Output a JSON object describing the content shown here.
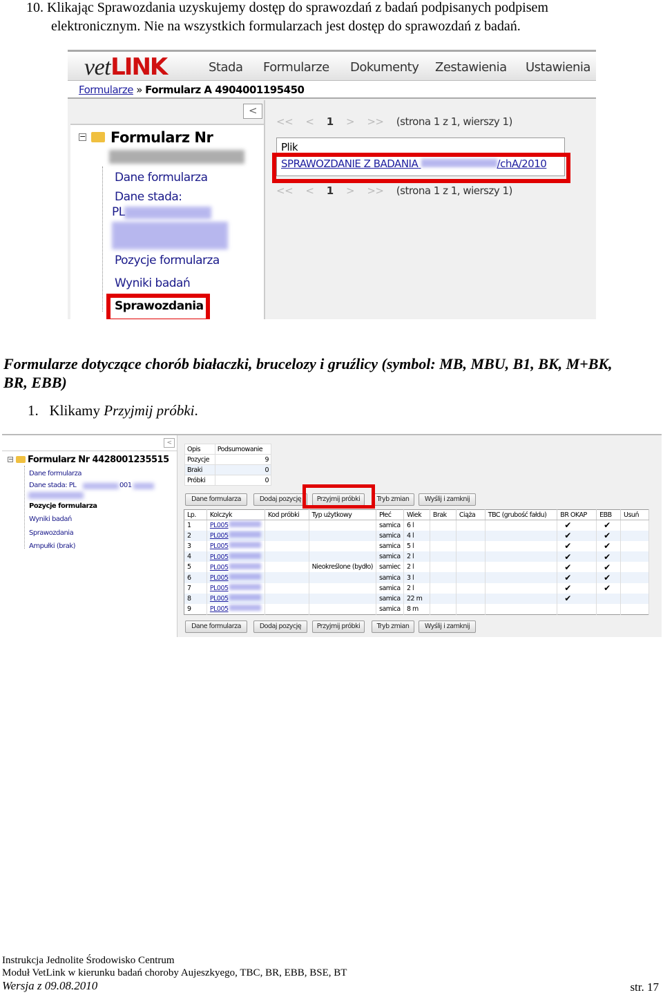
{
  "intro": {
    "line1": "10. Klikając Sprawozdania uzyskujemy dostęp do sprawozdań z badań podpisanych podpisem",
    "line2": "elektronicznym. Nie na wszystkich formularzach jest dostęp do sprawozdań z badań."
  },
  "shot1": {
    "logo": "vetLINK",
    "logo_a": "vet",
    "logo_b": "LINK",
    "menu": [
      "Stada",
      "Formularze",
      "Dokumenty",
      "Zestawienia",
      "Ustawienia"
    ],
    "breadcrumb": {
      "link": "Formularze",
      "sep": "»",
      "current": "Formularz A 4904001195450"
    },
    "collapse": "<",
    "tree": {
      "title": "Formularz Nr",
      "items": [
        "Dane formularza",
        "Dane stada:",
        "PL",
        "Pozycje formularza",
        "Wyniki badań",
        "Sprawozdania"
      ]
    },
    "pager": {
      "first": "<<",
      "prev": "<",
      "page": "1",
      "next": ">",
      "last": ">>",
      "info": "(strona 1 z 1, wierszy 1)"
    },
    "file_header": "Plik",
    "file_link_a": "SPRAWOZDANIE Z BADANIA",
    "file_link_b": "/chA/2010",
    "highlight_color": "#e00000"
  },
  "heading": {
    "line1": "Formularze dotyczące chorób białaczki, brucelozy i gruźlicy (symbol: MB, MBU, B1, BK, M+BK,",
    "line2": "BR, EBB)"
  },
  "step": {
    "num": "1.",
    "text": "Klikamy ",
    "em": "Przyjmij próbki",
    "end": "."
  },
  "shot2": {
    "collapse": "<",
    "tree": {
      "title": "Formularz Nr 4428001235515",
      "items": [
        "Dane formularza",
        "Dane stada: PL",
        "001",
        "Pozycje formularza",
        "Wyniki badań",
        "Sprawozdania",
        "Ampułki (brak)"
      ]
    },
    "summary": {
      "headers": [
        "Opis",
        "Podsumowanie"
      ],
      "rows": [
        [
          "Pozycje",
          "9"
        ],
        [
          "Braki",
          "0"
        ],
        [
          "Próbki",
          "0"
        ]
      ]
    },
    "buttons": [
      "Dane formularza",
      "Dodaj pozycję",
      "Przyjmij próbki",
      "Tryb zmian",
      "Wyślij i zamknij"
    ],
    "columns": [
      "Lp.",
      "Kolczyk",
      "Kod próbki",
      "Typ użytkowy",
      "Płeć",
      "Wiek",
      "Brak",
      "Ciąża",
      "TBC (grubość fałdu)",
      "BR OKAP",
      "EBB",
      "Usuń"
    ],
    "rows": [
      {
        "lp": "1",
        "kolczyk": "PL005",
        "typ": "",
        "plec": "samica",
        "wiek": "6 l",
        "br": "✔",
        "ebb": "✔"
      },
      {
        "lp": "2",
        "kolczyk": "PL005",
        "typ": "",
        "plec": "samica",
        "wiek": "4 l",
        "br": "✔",
        "ebb": "✔"
      },
      {
        "lp": "3",
        "kolczyk": "PL005",
        "typ": "",
        "plec": "samica",
        "wiek": "5 l",
        "br": "✔",
        "ebb": "✔"
      },
      {
        "lp": "4",
        "kolczyk": "PL005",
        "typ": "",
        "plec": "samica",
        "wiek": "2 l",
        "br": "✔",
        "ebb": "✔"
      },
      {
        "lp": "5",
        "kolczyk": "PL005",
        "typ": "Nieokreślone (bydło)",
        "plec": "samiec",
        "wiek": "2 l",
        "br": "✔",
        "ebb": "✔"
      },
      {
        "lp": "6",
        "kolczyk": "PL005",
        "typ": "",
        "plec": "samica",
        "wiek": "3 l",
        "br": "✔",
        "ebb": "✔"
      },
      {
        "lp": "7",
        "kolczyk": "PL005",
        "typ": "",
        "plec": "samica",
        "wiek": "2 l",
        "br": "✔",
        "ebb": "✔"
      },
      {
        "lp": "8",
        "kolczyk": "PL005",
        "typ": "",
        "plec": "samica",
        "wiek": "22 m",
        "br": "✔",
        "ebb": ""
      },
      {
        "lp": "9",
        "kolczyk": "PL005",
        "typ": "",
        "plec": "samica",
        "wiek": "8 m",
        "br": "",
        "ebb": ""
      }
    ]
  },
  "footer": {
    "line1": "Instrukcja Jednolite Środowisko Centrum",
    "line2": "Moduł VetLink w kierunku badań choroby Aujeszkyego, TBC, BR, EBB, BSE, BT",
    "version": "Wersja z 09.08.2010",
    "page": "str. 17"
  }
}
